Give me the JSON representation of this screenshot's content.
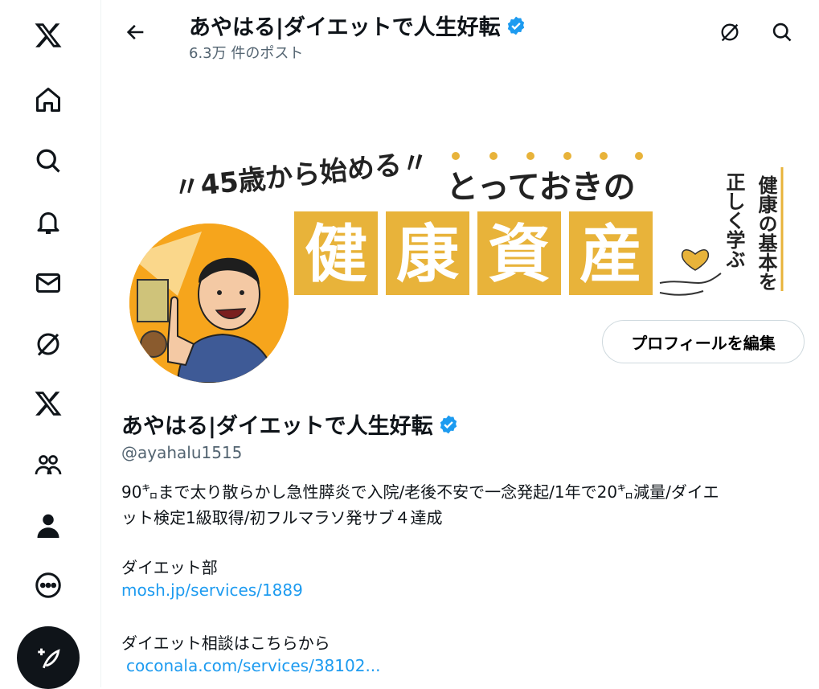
{
  "header": {
    "title": "あやはる|ダイエットで人生好転",
    "post_count": "6.3万 件のポスト"
  },
  "banner": {
    "line1": "〃45歳から始める〃",
    "line2": "とっておきの",
    "chars": [
      "健",
      "康",
      "資",
      "産"
    ],
    "side_col1": "健康の基本を",
    "side_col2": "正しく学ぶ"
  },
  "profile": {
    "name": "あやはる|ダイエットで人生好転",
    "handle": "@ayahalu1515",
    "edit_label": "プロフィールを編集",
    "bio_line1": "90㌔まで太り散らかし急性膵炎で入院/老後不安で一念発起/1年で20㌔減量/ダイエ",
    "bio_line2": "ット検定1級取得/初フルマラソ発サブ４達成",
    "section1_title": "ダイエット部",
    "section1_link": "mosh.jp/services/1889",
    "section2_title": "ダイエット相談はこちらから",
    "section2_link": "coconala.com/services/38102..."
  },
  "sidebar": {
    "items": [
      "logo-x",
      "home",
      "explore",
      "notifications",
      "messages",
      "grok",
      "premium",
      "communities",
      "profile",
      "more"
    ]
  },
  "colors": {
    "accent": "#1d9bf0",
    "banner_yellow": "#e8b33a",
    "text": "#0f1419",
    "muted": "#536471"
  }
}
